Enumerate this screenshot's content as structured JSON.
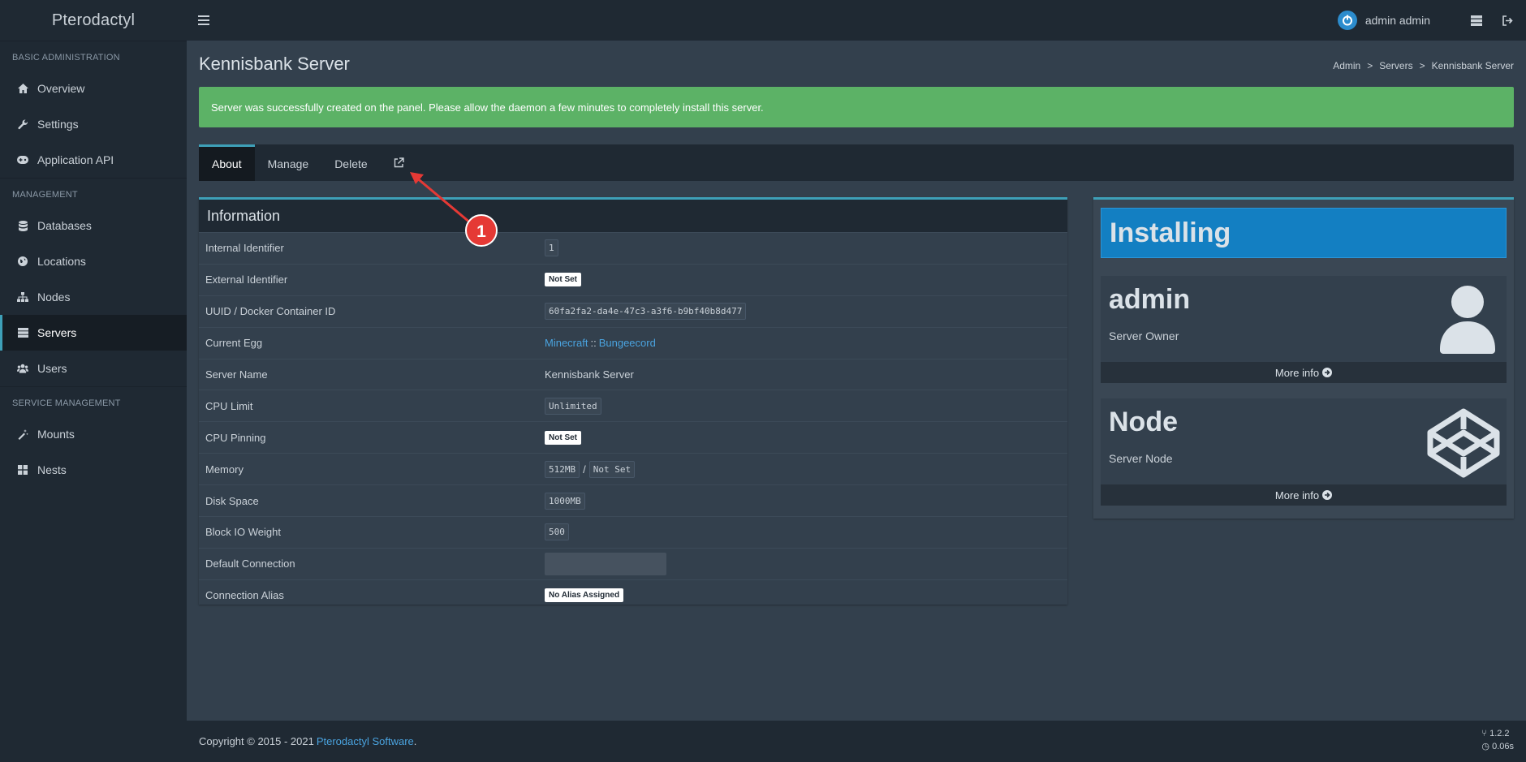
{
  "header": {
    "brand": "Pterodactyl",
    "user_name": "admin admin"
  },
  "sidebar": {
    "sections": [
      {
        "title": "BASIC ADMINISTRATION"
      },
      {
        "title": "MANAGEMENT"
      },
      {
        "title": "SERVICE MANAGEMENT"
      }
    ],
    "items": [
      {
        "label": "Overview",
        "icon": "home-icon"
      },
      {
        "label": "Settings",
        "icon": "wrench-icon"
      },
      {
        "label": "Application API",
        "icon": "gamepad-icon"
      },
      {
        "label": "Databases",
        "icon": "database-icon"
      },
      {
        "label": "Locations",
        "icon": "globe-icon"
      },
      {
        "label": "Nodes",
        "icon": "sitemap-icon"
      },
      {
        "label": "Servers",
        "icon": "server-icon"
      },
      {
        "label": "Users",
        "icon": "users-icon"
      },
      {
        "label": "Mounts",
        "icon": "magic-icon"
      },
      {
        "label": "Nests",
        "icon": "th-large-icon"
      }
    ]
  },
  "page": {
    "title": "Kennisbank Server",
    "breadcrumb": [
      "Admin",
      "Servers",
      "Kennisbank Server"
    ],
    "alert": "Server was successfully created on the panel. Please allow the daemon a few minutes to completely install this server."
  },
  "tabs": [
    "About",
    "Manage",
    "Delete"
  ],
  "info": {
    "title": "Information",
    "rows": {
      "internal_identifier": {
        "label": "Internal Identifier",
        "value": "1"
      },
      "external_identifier": {
        "label": "External Identifier",
        "value": "Not Set"
      },
      "uuid": {
        "label": "UUID / Docker Container ID",
        "value": "60fa2fa2-da4e-47c3-a3f6-b9bf40b8d477"
      },
      "egg": {
        "label": "Current Egg",
        "nest": "Minecraft",
        "separator": "::",
        "egg": "Bungeecord"
      },
      "server_name": {
        "label": "Server Name",
        "value": "Kennisbank Server"
      },
      "cpu_limit": {
        "label": "CPU Limit",
        "value": "Unlimited"
      },
      "cpu_pinning": {
        "label": "CPU Pinning",
        "value": "Not Set"
      },
      "memory": {
        "label": "Memory",
        "value": "512MB",
        "separator": "/",
        "swap": "Not Set"
      },
      "disk": {
        "label": "Disk Space",
        "value": "1000MB"
      },
      "block_io": {
        "label": "Block IO Weight",
        "value": "500"
      },
      "default_connection": {
        "label": "Default Connection"
      },
      "connection_alias": {
        "label": "Connection Alias",
        "value": "No Alias Assigned"
      }
    }
  },
  "status": {
    "label": "Installing",
    "color": "#137fc2"
  },
  "owner_box": {
    "title": "admin",
    "subtitle": "Server Owner",
    "more": "More info"
  },
  "node_box": {
    "title": "Node",
    "subtitle": "Server Node",
    "more": "More info"
  },
  "annotation": {
    "number": "1",
    "color": "#e53935"
  },
  "footer": {
    "copyright": "Copyright © 2015 - 2021",
    "link": "Pterodactyl Software",
    "period": ".",
    "version": "1.2.2",
    "time": "0.06s"
  }
}
